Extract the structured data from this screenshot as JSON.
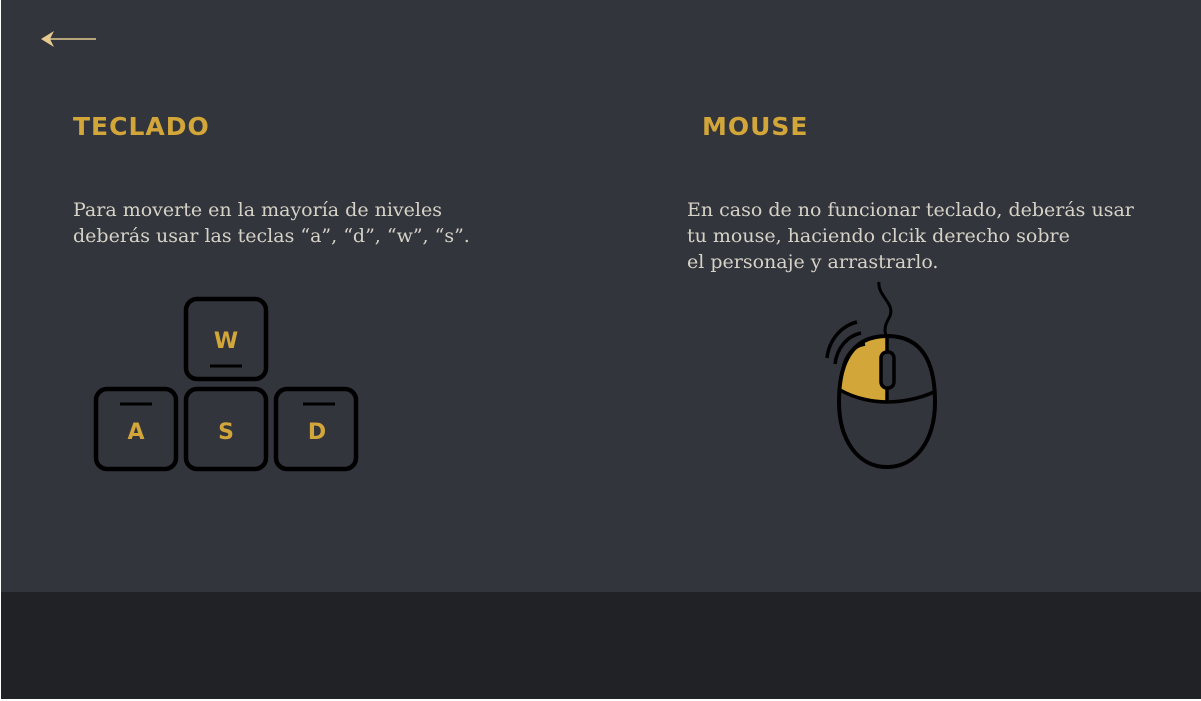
{
  "navigation": {
    "back_icon": "arrow-left-icon"
  },
  "keyboard": {
    "title": "TECLADO",
    "description_lines": [
      "Para moverte en la mayoría de niveles",
      "deberás usar las teclas “a”, “d”, “w”, “s”."
    ],
    "keys": [
      "W",
      "A",
      "S",
      "D"
    ],
    "icon": "wasd-keys-icon"
  },
  "mouse": {
    "title": "MOUSE",
    "description_lines": [
      "En caso de no funcionar teclado, deberás usar",
      "tu mouse, haciendo clcik derecho sobre",
      "el personaje y arrastrarlo."
    ],
    "icon": "mouse-left-click-icon"
  },
  "colors": {
    "background": "#32353c",
    "footer": "#212226",
    "accent": "#d3a63a",
    "text": "#d6d2c7",
    "outline": "#000000"
  }
}
